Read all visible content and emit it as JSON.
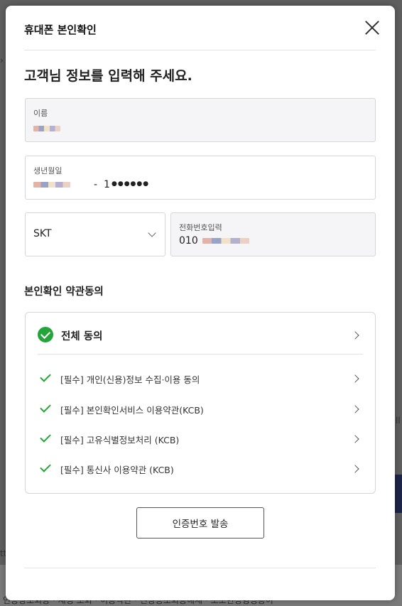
{
  "background": {
    "footer_text": "인증당조회동 · 재정 조회 · 이용약관 · 전당등조회동해제 · 조조현정형명동이",
    "left_mark": "›",
    "left_mark2": "tt",
    "right_mark": "ll"
  },
  "modal": {
    "title": "휴대폰 본인확인",
    "heading": "고객님 정보를 입력해 주세요."
  },
  "form": {
    "name": {
      "label": "이름"
    },
    "birth": {
      "label": "생년월일",
      "separator": "-",
      "gender_digit": "1",
      "masked": "●●●●●●"
    },
    "carrier": {
      "selected": "SKT"
    },
    "phone": {
      "label": "전화번호입력",
      "prefix": "010"
    }
  },
  "agreement": {
    "section_title": "본인확인 약관동의",
    "all_label": "전체 동의",
    "all_checked": true,
    "terms": [
      {
        "label": "[필수] 개인(신용)정보 수집·이용 동의",
        "checked": true
      },
      {
        "label": "[필수] 본인확인서비스 이용약관(KCB)",
        "checked": true
      },
      {
        "label": "[필수] 고유식별정보처리 (KCB)",
        "checked": true
      },
      {
        "label": "[필수] 통신사 이용약관 (KCB)",
        "checked": true
      }
    ]
  },
  "actions": {
    "send_label": "인증번호 발송"
  },
  "colors": {
    "accent_green": "#23a53a",
    "input_gray": "#f5f5f7"
  }
}
